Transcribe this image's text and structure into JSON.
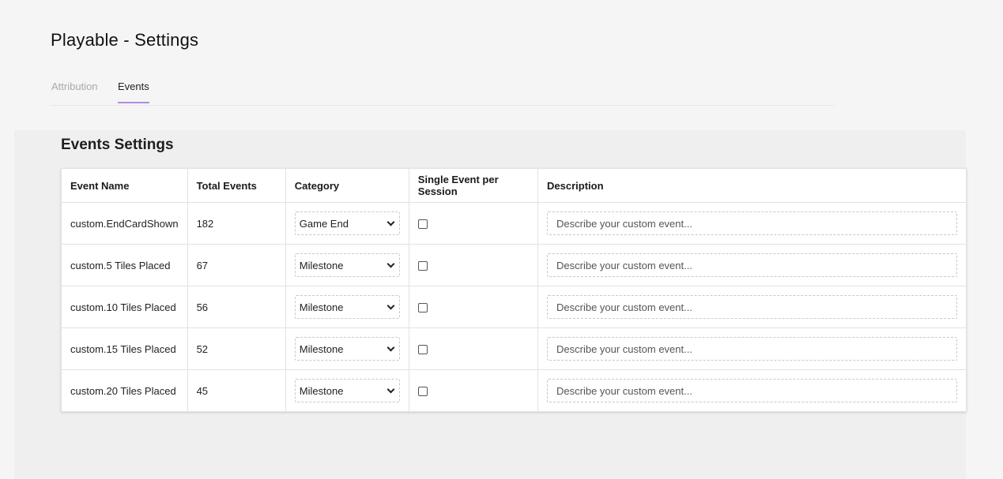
{
  "page_title": "Playable - Settings",
  "tabs": [
    {
      "label": "Attribution",
      "active": false
    },
    {
      "label": "Events",
      "active": true
    }
  ],
  "section_title": "Events Settings",
  "table": {
    "columns": [
      "Event Name",
      "Total Events",
      "Category",
      "Single Event per Session",
      "Description"
    ],
    "rows": [
      {
        "event_name": "custom.EndCardShown",
        "total": "182",
        "category": "Game End",
        "single": false,
        "description_placeholder": "Describe your custom event..."
      },
      {
        "event_name": "custom.5 Tiles Placed",
        "total": "67",
        "category": "Milestone",
        "single": false,
        "description_placeholder": "Describe your custom event..."
      },
      {
        "event_name": "custom.10 Tiles Placed",
        "total": "56",
        "category": "Milestone",
        "single": false,
        "description_placeholder": "Describe your custom event..."
      },
      {
        "event_name": "custom.15 Tiles Placed",
        "total": "52",
        "category": "Milestone",
        "single": false,
        "description_placeholder": "Describe your custom event..."
      },
      {
        "event_name": "custom.20 Tiles Placed",
        "total": "45",
        "category": "Milestone",
        "single": false,
        "description_placeholder": "Describe your custom event..."
      }
    ]
  },
  "colors": {
    "tab_underline": "#b388e8",
    "background": "#f5f5f5"
  }
}
